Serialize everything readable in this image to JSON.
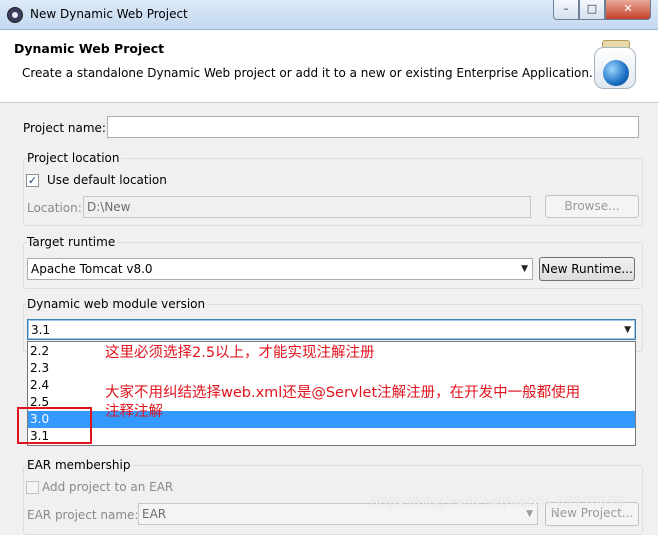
{
  "window": {
    "title": "New Dynamic Web Project",
    "min_icon": "minimize-icon",
    "max_icon": "maximize-icon",
    "close_icon": "close-icon",
    "min_glyph": "–",
    "max_glyph": "□",
    "close_glyph": "✕"
  },
  "header": {
    "title": "Dynamic Web Project",
    "description": "Create a standalone Dynamic Web project or add it to a new or existing Enterprise Application."
  },
  "project_name": {
    "label": "Project name:",
    "value": ""
  },
  "location": {
    "group_label": "Project location",
    "use_default_label": "Use default location",
    "use_default_checked": true,
    "check_glyph": "✓",
    "location_label": "Location:",
    "location_value": "D:\\New",
    "browse_label": "Browse..."
  },
  "runtime": {
    "group_label": "Target runtime",
    "selected": "Apache Tomcat v8.0",
    "new_label": "New Runtime..."
  },
  "module_version": {
    "group_label": "Dynamic web module version",
    "selected": "3.1",
    "options": [
      "2.2",
      "2.3",
      "2.4",
      "2.5",
      "3.0",
      "3.1"
    ],
    "highlighted_index": 4
  },
  "annotations": {
    "note1": "这里必须选择2.5以上，才能实现注解注册",
    "note2_line1": "大家不用纠结选择web.xml还是@Servlet注解注册，在开发中一般都使用",
    "note2_line2": "注释注解"
  },
  "ear": {
    "group_label": "EAR membership",
    "add_label": "Add project to an EAR",
    "add_checked": false,
    "project_label": "EAR project name:",
    "project_value": "EAR",
    "new_label": "New Project..."
  },
  "watermark": "https://blog.csdn.net/weixin_42110638",
  "colors": {
    "accent_red": "#e0141e",
    "selection_blue": "#3399ff"
  }
}
